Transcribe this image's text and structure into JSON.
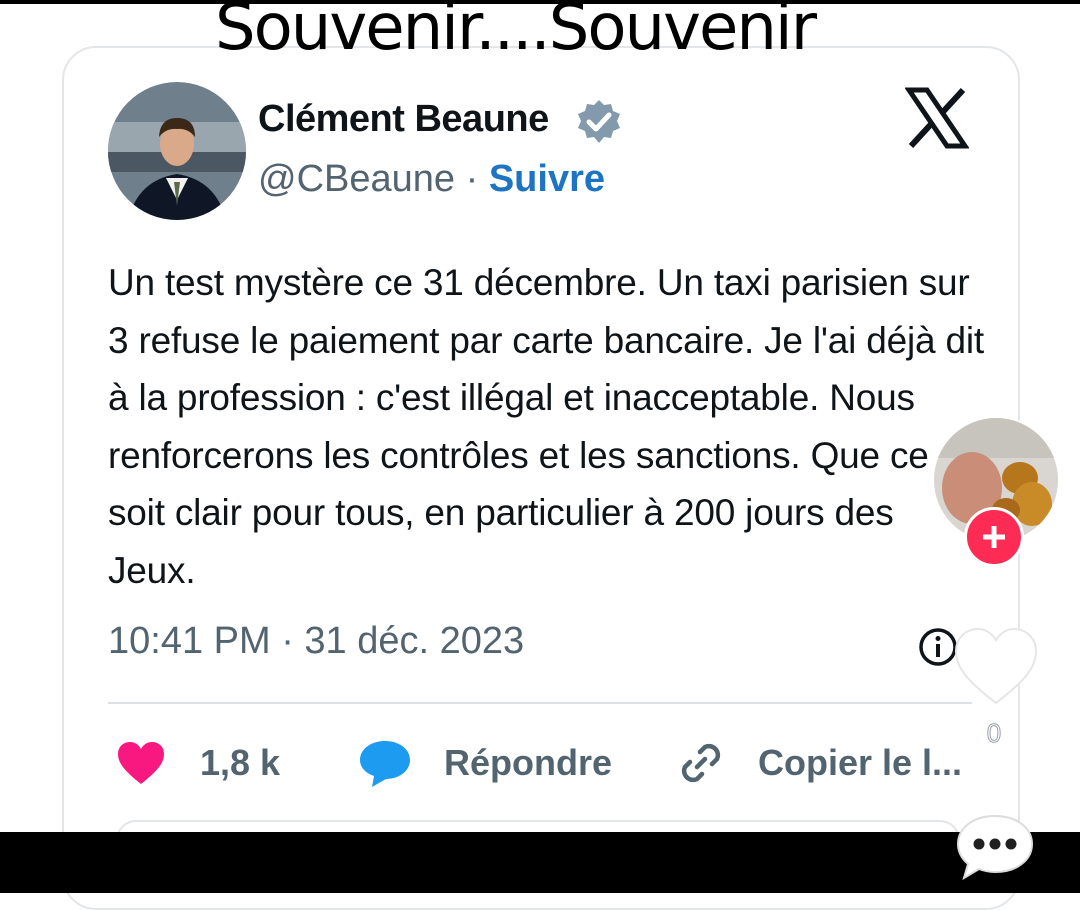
{
  "overlay_title": "Souvenir....Souvenir",
  "tweet": {
    "author_name": "Clément Beaune",
    "handle": "@CBeaune",
    "separator": " · ",
    "follow_label": "Suivre",
    "text": "Un test mystère ce 31 décembre. Un taxi parisien sur 3 refuse le paiement par carte bancaire. Je l'ai déjà dit à la profession : c'est illégal et inacceptable. Nous renforcerons les contrôles et les sanctions. Que ce soit clair pour tous,  en particulier à 200 jours des Jeux.",
    "timestamp": "10:41 PM · 31 déc. 2023",
    "likes_label": "1,8 k",
    "reply_label": "Répondre",
    "copy_label": "Copier le l..."
  },
  "side_panel": {
    "like_count": "0"
  },
  "colors": {
    "follow_blue": "#1d74c3",
    "heart_pink": "#f91880",
    "reply_blue": "#1d9bf0",
    "verified_gray": "#829aab",
    "tiktok_red": "#fe2c55"
  },
  "icons": [
    "verified-badge-icon",
    "x-logo-icon",
    "info-icon",
    "heart-icon",
    "reply-bubble-icon",
    "link-icon",
    "plus-icon",
    "more-dots-icon"
  ]
}
